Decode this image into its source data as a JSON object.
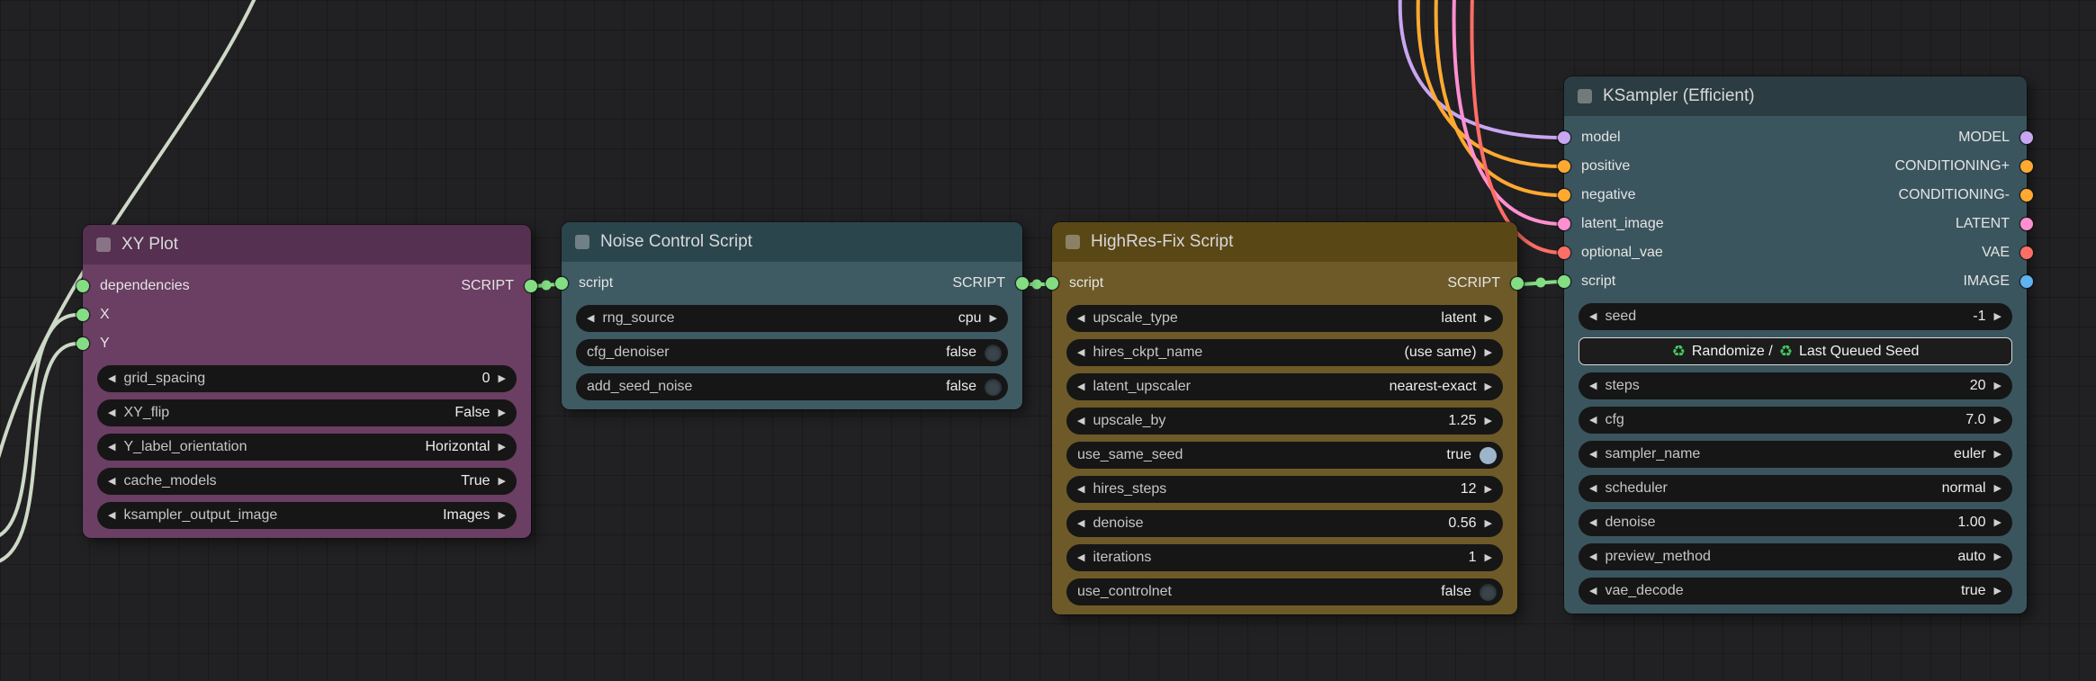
{
  "colors": {
    "script": "#83de83",
    "model": "#c9a6f2",
    "conditioning": "#ffa931",
    "latent": "#ff8fd0",
    "vae": "#ff6e66",
    "image": "#5fb3f0",
    "sage_link": "#cdd9c6"
  },
  "nodes": [
    {
      "title": "XY Plot",
      "inputs": [
        {
          "label": "dependencies"
        },
        {
          "label": "X"
        },
        {
          "label": "Y"
        }
      ],
      "outputs": [
        {
          "label": "SCRIPT"
        }
      ],
      "widgets": [
        {
          "label": "grid_spacing",
          "value": "0"
        },
        {
          "label": "XY_flip",
          "value": "False"
        },
        {
          "label": "Y_label_orientation",
          "value": "Horizontal"
        },
        {
          "label": "cache_models",
          "value": "True"
        },
        {
          "label": "ksampler_output_image",
          "value": "Images"
        }
      ]
    },
    {
      "title": "Noise Control Script",
      "inputs": [
        {
          "label": "script"
        }
      ],
      "outputs": [
        {
          "label": "SCRIPT"
        }
      ],
      "widgets": [
        {
          "label": "rng_source",
          "value": "cpu"
        },
        {
          "label": "cfg_denoiser",
          "value": "false"
        },
        {
          "label": "add_seed_noise",
          "value": "false"
        }
      ]
    },
    {
      "title": "HighRes-Fix Script",
      "inputs": [
        {
          "label": "script"
        }
      ],
      "outputs": [
        {
          "label": "SCRIPT"
        }
      ],
      "widgets": [
        {
          "label": "upscale_type",
          "value": "latent"
        },
        {
          "label": "hires_ckpt_name",
          "value": "(use same)"
        },
        {
          "label": "latent_upscaler",
          "value": "nearest-exact"
        },
        {
          "label": "upscale_by",
          "value": "1.25"
        },
        {
          "label": "use_same_seed",
          "value": "true"
        },
        {
          "label": "hires_steps",
          "value": "12"
        },
        {
          "label": "denoise",
          "value": "0.56"
        },
        {
          "label": "iterations",
          "value": "1"
        },
        {
          "label": "use_controlnet",
          "value": "false"
        }
      ]
    },
    {
      "title": "KSampler (Efficient)",
      "inputs": [
        {
          "label": "model"
        },
        {
          "label": "positive"
        },
        {
          "label": "negative"
        },
        {
          "label": "latent_image"
        },
        {
          "label": "optional_vae"
        },
        {
          "label": "script"
        }
      ],
      "outputs": [
        {
          "label": "MODEL"
        },
        {
          "label": "CONDITIONING+"
        },
        {
          "label": "CONDITIONING-"
        },
        {
          "label": "LATENT"
        },
        {
          "label": "VAE"
        },
        {
          "label": "IMAGE"
        }
      ],
      "seed_button": {
        "recycle_icon": "♻",
        "text_left": "Randomize /",
        "text_right": "Last Queued Seed"
      },
      "widgets": [
        {
          "label": "seed",
          "value": "-1"
        },
        {
          "label": "steps",
          "value": "20"
        },
        {
          "label": "cfg",
          "value": "7.0"
        },
        {
          "label": "sampler_name",
          "value": "euler"
        },
        {
          "label": "scheduler",
          "value": "normal"
        },
        {
          "label": "denoise",
          "value": "1.00"
        },
        {
          "label": "preview_method",
          "value": "auto"
        },
        {
          "label": "vae_decode",
          "value": "true"
        }
      ]
    }
  ]
}
